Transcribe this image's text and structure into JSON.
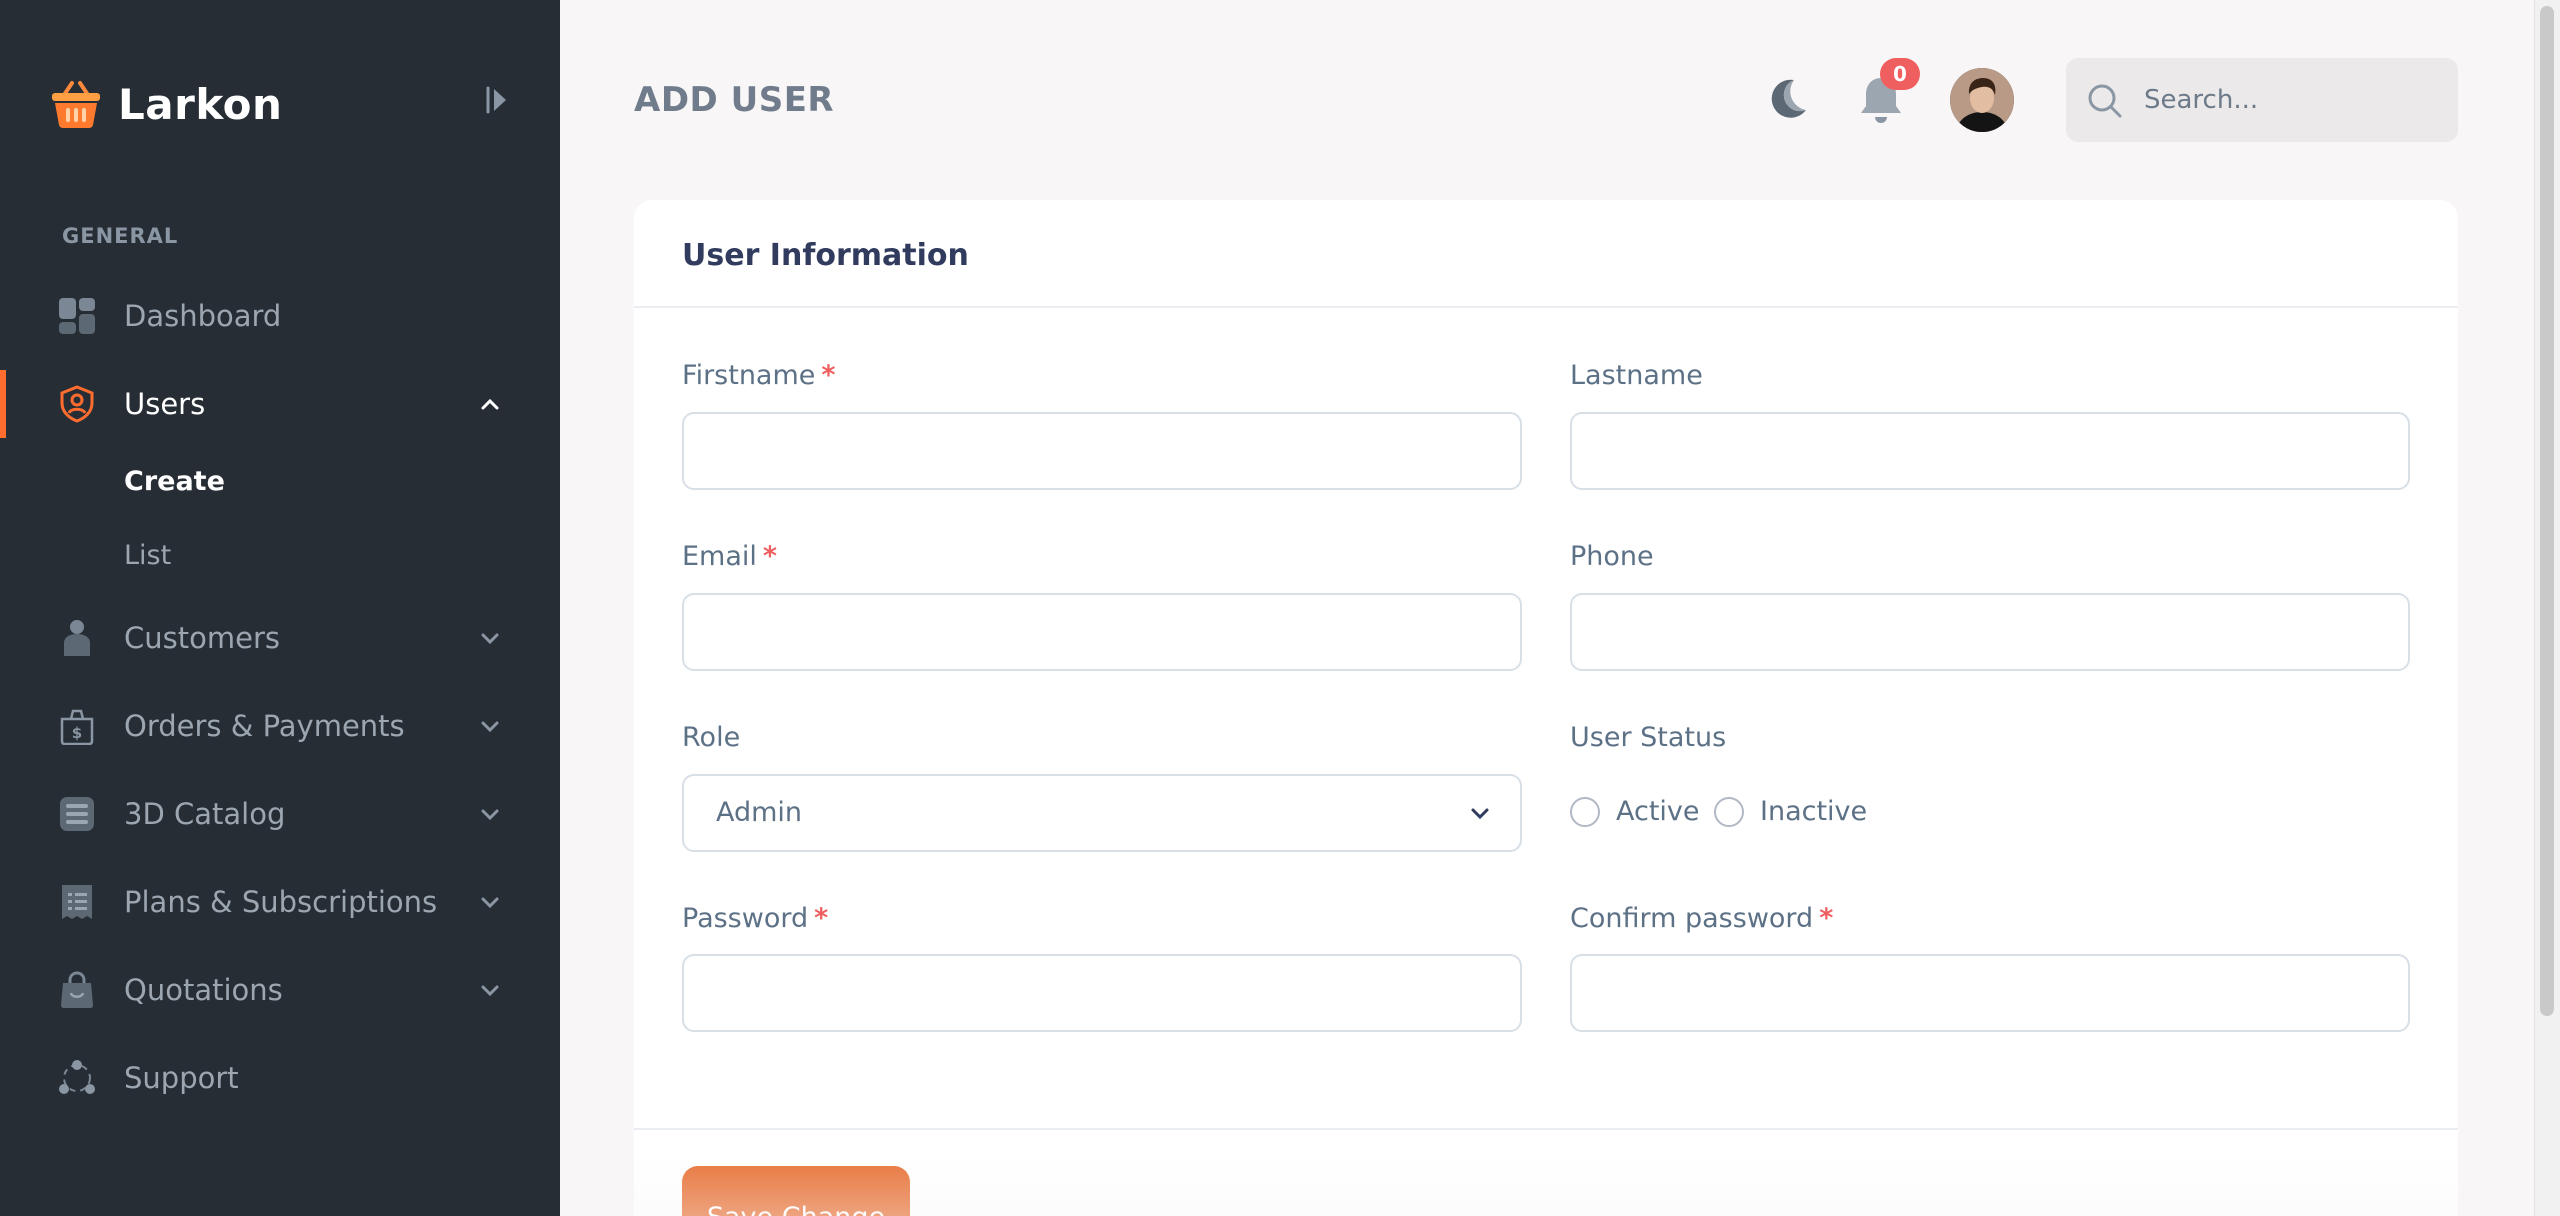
{
  "brand": {
    "name": "Larkon"
  },
  "sidebar": {
    "section_label": "GENERAL",
    "items": [
      {
        "label": "Dashboard",
        "icon": "dashboard-icon"
      },
      {
        "label": "Users",
        "icon": "user-shield-icon",
        "active": true,
        "subitems": [
          {
            "label": "Create",
            "current": true
          },
          {
            "label": "List"
          }
        ]
      },
      {
        "label": "Customers",
        "icon": "customer-icon"
      },
      {
        "label": "Orders & Payments",
        "icon": "cash-bag-icon"
      },
      {
        "label": "3D Catalog",
        "icon": "catalog-icon"
      },
      {
        "label": "Plans & Subscriptions",
        "icon": "receipt-icon"
      },
      {
        "label": "Quotations",
        "icon": "shopping-bag-icon"
      },
      {
        "label": "Support",
        "icon": "support-icon"
      }
    ]
  },
  "header": {
    "title": "ADD USER",
    "notification_count": "0",
    "search": {
      "placeholder": "Search..."
    }
  },
  "form": {
    "title": "User Information",
    "firstname_label": "Firstname",
    "lastname_label": "Lastname",
    "email_label": "Email",
    "phone_label": "Phone",
    "role_label": "Role",
    "role_value": "Admin",
    "status_label": "User Status",
    "status_options": [
      "Active",
      "Inactive"
    ],
    "password_label": "Password",
    "confirm_password_label": "Confirm password",
    "required_mark": "*",
    "save_label": "Save Change"
  },
  "colors": {
    "accent": "#ff6c2f",
    "sidebar_bg": "#262d34",
    "required": "#ef5f5f",
    "button": "#e8763d"
  }
}
